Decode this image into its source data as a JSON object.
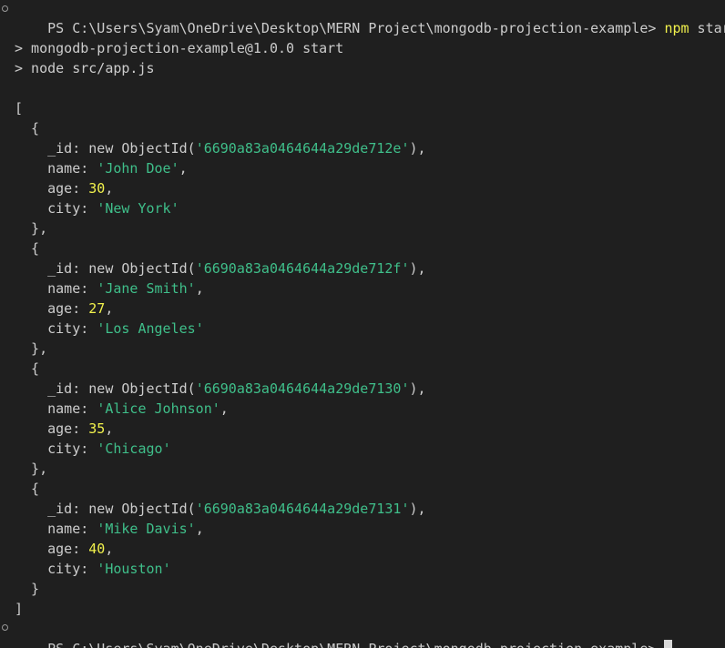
{
  "prompt": {
    "text": "PS C:\\Users\\Syam\\OneDrive\\Desktop\\MERN Project\\mongodb-projection-example>",
    "command": "npm",
    "command_arg": " start"
  },
  "script_header": {
    "line1": "> mongodb-projection-example@1.0.0 start",
    "line2": "> node src/app.js"
  },
  "output": {
    "open_bracket": "[",
    "close_bracket": "]",
    "records": [
      {
        "id": "6690a83a0464644a29de712e",
        "name": "John Doe",
        "age": "30",
        "city": "New York"
      },
      {
        "id": "6690a83a0464644a29de712f",
        "name": "Jane Smith",
        "age": "27",
        "city": "Los Angeles"
      },
      {
        "id": "6690a83a0464644a29de7130",
        "name": "Alice Johnson",
        "age": "35",
        "city": "Chicago"
      },
      {
        "id": "6690a83a0464644a29de7131",
        "name": "Mike Davis",
        "age": "40",
        "city": "Houston"
      }
    ]
  },
  "final_prompt": {
    "text": "PS C:\\Users\\Syam\\OneDrive\\Desktop\\MERN Project\\mongodb-projection-example>"
  },
  "colors": {
    "background": "#1f1f1f",
    "text": "#cccccc",
    "string": "#3fbf8a",
    "number": "#f1f14c",
    "command": "#f1f14c"
  }
}
